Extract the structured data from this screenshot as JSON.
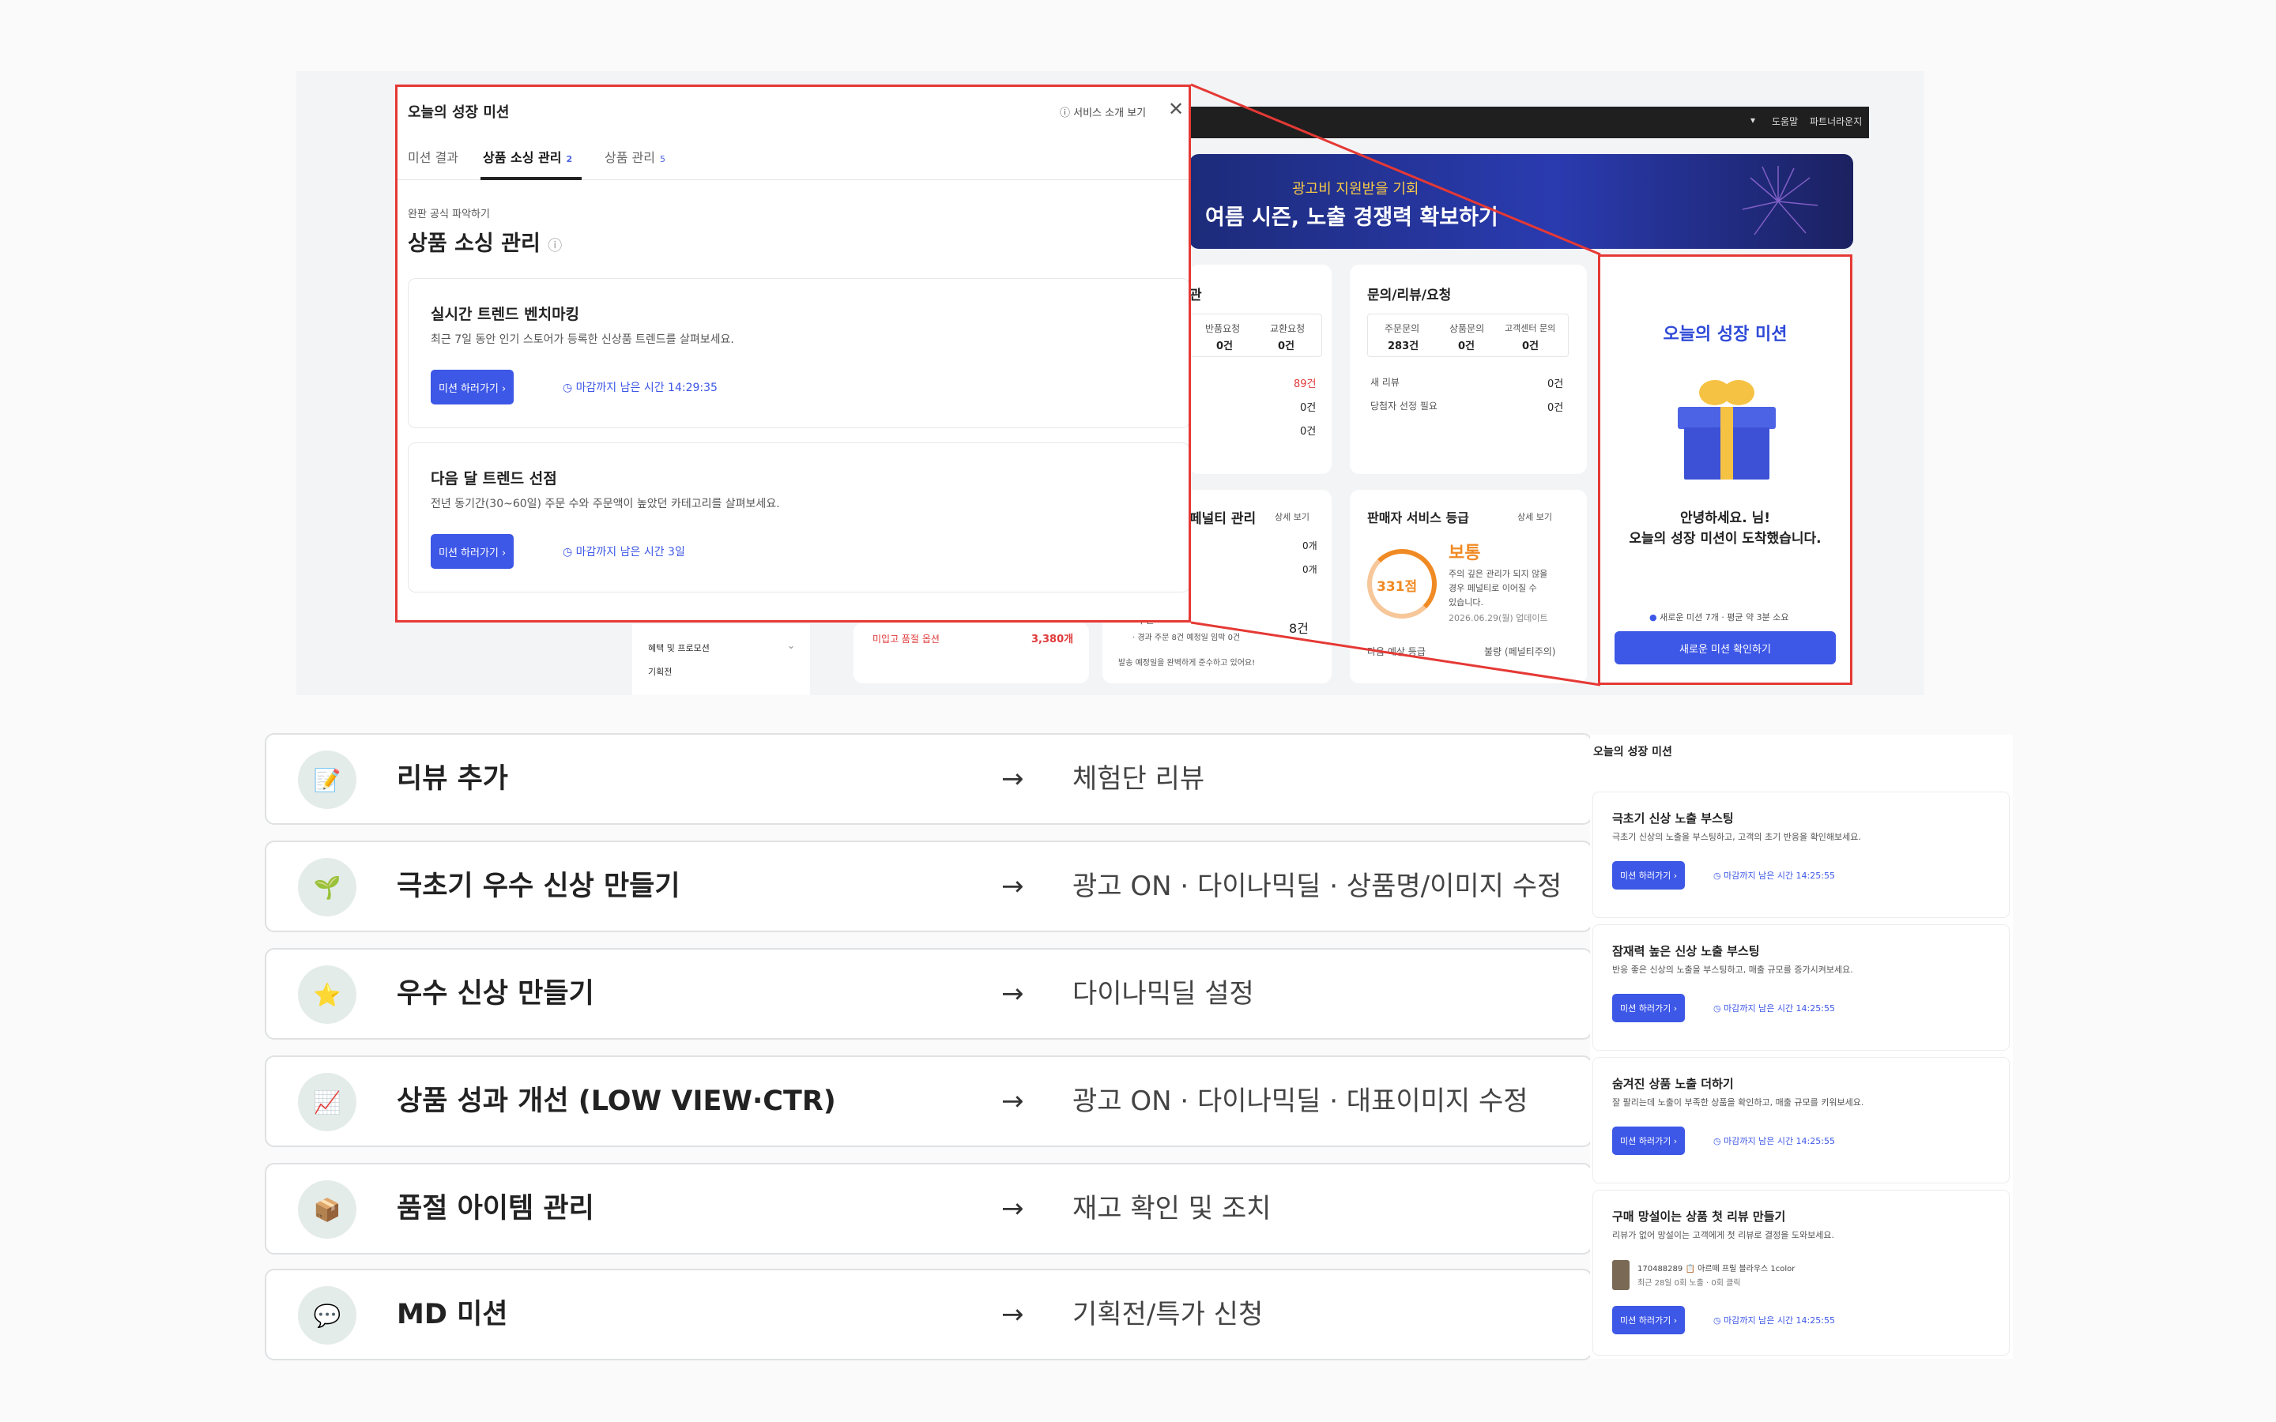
{
  "dashboard": {
    "topbar": {
      "help": "도움말",
      "partner": "파트너라운지"
    },
    "banner": {
      "sub": "광고비 지원받을 기회",
      "main": "여름 시즌, 노출 경쟁력 확보하기"
    },
    "orders_card": {
      "title": "관",
      "returns_label": "반품요청",
      "returns_val": "0건",
      "exchange_label": "교환요청",
      "exchange_val": "0건",
      "v1": "89건",
      "v2": "0건",
      "v3": "0건"
    },
    "inquiry_card": {
      "title": "문의/리뷰/요청",
      "order_q_label": "주문문의",
      "order_q_val": "283건",
      "product_q_label": "상품문의",
      "product_q_val": "0건",
      "center_q_label": "고객센터 문의",
      "center_q_val": "0건",
      "new_review_label": "새 리뷰",
      "new_review_val": "0건",
      "winner_label": "당첨자 선정 필요",
      "winner_val": "0건"
    },
    "penalty_card": {
      "title": "페널티 관리",
      "more": "상세 보기",
      "v1": "0개",
      "v2": "0개",
      "order_label": "·주문",
      "order_val": "8건",
      "row1": "· 경과 주문 8건  예정일 임박 0건",
      "note": "발송 예정일을 완벽하게 준수하고 있어요!"
    },
    "grade_card": {
      "title": "판매자 서비스 등급",
      "more": "상세 보기",
      "score": "331점",
      "grade": "보통",
      "desc1": "주의 깊은 관리가 되지 않을",
      "desc2": "경우 페널티로 이어질 수",
      "desc3": "있습니다.",
      "date": "2026.06.29(월) 업데이트",
      "next_label": "다음 예상 등급",
      "next_val": "불량 (페널티주의)"
    },
    "stock_card": {
      "label": "미입고 품절 옵션",
      "val": "3,380개"
    },
    "sidebar": {
      "benefit": "혜택 및 프로모션",
      "plan": "기획전"
    }
  },
  "modal": {
    "title": "오늘의 성장 미션",
    "service_link": "서비스 소개 보기",
    "tabs": [
      {
        "label": "미션 결과",
        "count": ""
      },
      {
        "label": "상품 소싱 관리",
        "count": "2"
      },
      {
        "label": "상품 관리",
        "count": "5"
      }
    ],
    "crumb": "완판 공식 파악하기",
    "heading": "상품 소싱 관리",
    "cards": [
      {
        "title": "실시간 트렌드 벤치마킹",
        "desc": "최근 7일 동안 인기 스토어가 등록한 신상품 트렌드를 살펴보세요.",
        "button": "미션 하러가기 ›",
        "deadline": "마감까지 남은 시간 14:29:35"
      },
      {
        "title": "다음 달 트렌드 선점",
        "desc": "전년 동기간(30~60일) 주문 수와 주문액이 높았던 카테고리를 살펴보세요.",
        "button": "미션 하러가기 ›",
        "deadline": "마감까지 남은 시간 3일"
      }
    ]
  },
  "right_panel": {
    "title": "오늘의 성장 미션",
    "greeting1": "안녕하세요.              님!",
    "greeting2": "오늘의 성장 미션이 도착했습니다.",
    "info": "새로운 미션 7개 · 평균 약 3분 소요",
    "button": "새로운 미션 확인하기"
  },
  "mission_rows": [
    {
      "icon": "pencil-icon",
      "glyph": "📝",
      "label": "리뷰 추가",
      "arrow": "→",
      "action": "체험단 리뷰"
    },
    {
      "icon": "sprout-icon",
      "glyph": "🌱",
      "label": "극초기 우수 신상 만들기",
      "arrow": "→",
      "action": "광고 ON · 다이나믹딜 · 상품명/이미지 수정"
    },
    {
      "icon": "star-icon",
      "glyph": "⭐",
      "label": "우수 신상 만들기",
      "arrow": "→",
      "action": "다이나믹딜 설정"
    },
    {
      "icon": "chart-icon",
      "glyph": "📈",
      "label": "상품 성과 개선 (LOW VIEW·CTR)",
      "arrow": "→",
      "action": "광고 ON · 다이나믹딜 · 대표이미지 수정"
    },
    {
      "icon": "box-icon",
      "glyph": "📦",
      "label": "품절 아이템 관리",
      "arrow": "→",
      "action": "재고 확인 및 조치"
    },
    {
      "icon": "speech-bubble-icon",
      "glyph": "💬",
      "label": "MD 미션",
      "arrow": "→",
      "action": "기획전/특가 신청"
    }
  ],
  "bottom_panel": {
    "title": "오늘의 성장 미션",
    "cards": [
      {
        "title": "극초기 신상 노출 부스팅",
        "desc": "극초기 신상의 노출을 부스팅하고, 고객의 초기 반응을 확인해보세요.",
        "button": "미션 하러가기 ›",
        "deadline": "마감까지 남은 시간 14:25:55"
      },
      {
        "title": "잠재력 높은 신상 노출 부스팅",
        "desc": "반응 좋은 신상의 노출을 부스팅하고, 매출 규모를 증가시켜보세요.",
        "button": "미션 하러가기 ›",
        "deadline": "마감까지 남은 시간 14:25:55"
      },
      {
        "title": "숨겨진 상품 노출 더하기",
        "desc": "잘 팔리는데 노출이 부족한 상품을 확인하고, 매출 규모를 키워보세요.",
        "button": "미션 하러가기 ›",
        "deadline": "마감까지 남은 시간 14:25:55"
      },
      {
        "title": "구매 망설이는 상품 첫 리뷰 만들기",
        "desc": "리뷰가 없어 망설이는 고객에게 첫 리뷰로 결정을 도와보세요.",
        "product": "170488289 📋 아르떼 프릴 블라우스 1color",
        "stats": "최근 28일 0회 노출 · 0회 클릭",
        "button": "미션 하러가기 ›",
        "deadline": "마감까지 남은 시간 14:25:55"
      }
    ]
  },
  "colors": {
    "accent": "#3d57e6",
    "highlight": "#e53935",
    "warn": "#f08a24"
  }
}
